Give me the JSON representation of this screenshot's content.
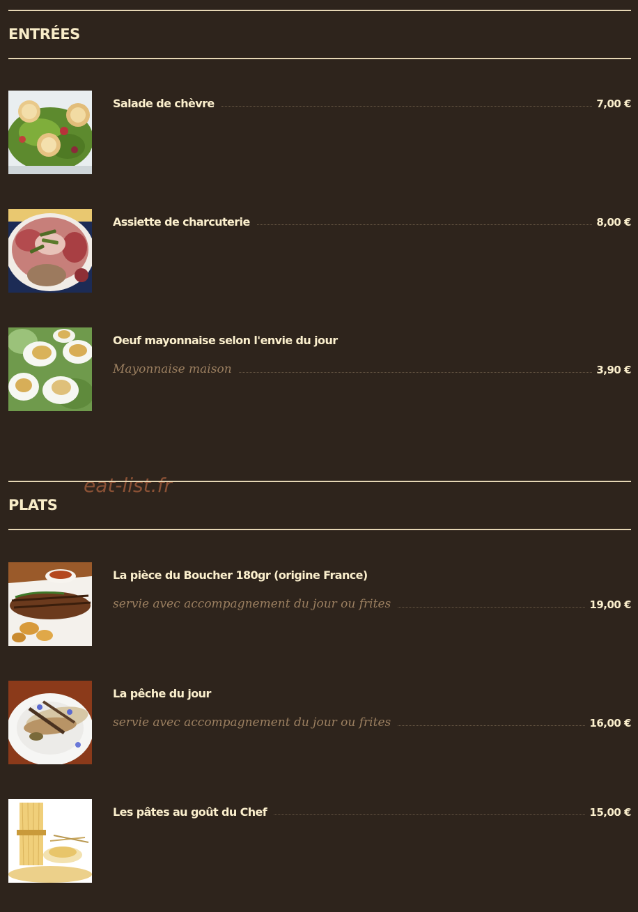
{
  "sections": [
    {
      "title": "ENTRÉES",
      "items": [
        {
          "name": "Salade de chèvre",
          "description": "",
          "price": "7,00 €",
          "image": "goat-cheese-salad"
        },
        {
          "name": "Assiette de charcuterie",
          "description": "",
          "price": "8,00 €",
          "image": "charcuterie-plate"
        },
        {
          "name": "Oeuf mayonnaise selon l'envie du jour",
          "description": "Mayonnaise maison",
          "price": "3,90 €",
          "image": "egg-mayonnaise"
        }
      ]
    },
    {
      "title": "PLATS",
      "items": [
        {
          "name": "La pièce du Boucher 180gr (origine France)",
          "description": "servie avec accompagnement du jour ou frites",
          "price": "19,00 €",
          "image": "steak-plate"
        },
        {
          "name": "La pêche du jour",
          "description": "servie avec accompagnement du jour ou frites",
          "price": "16,00 €",
          "image": "fish-plate"
        },
        {
          "name": "Les pâtes au goût du Chef",
          "description": "",
          "price": "15,00 €",
          "image": "pasta"
        }
      ]
    }
  ],
  "watermark": "eat-list.fr",
  "colors": {
    "background": "#2e241c",
    "rule": "#e6d7b5",
    "text": "#fbefcd",
    "description": "#9b7f60",
    "watermark": "#9c5a3a"
  }
}
